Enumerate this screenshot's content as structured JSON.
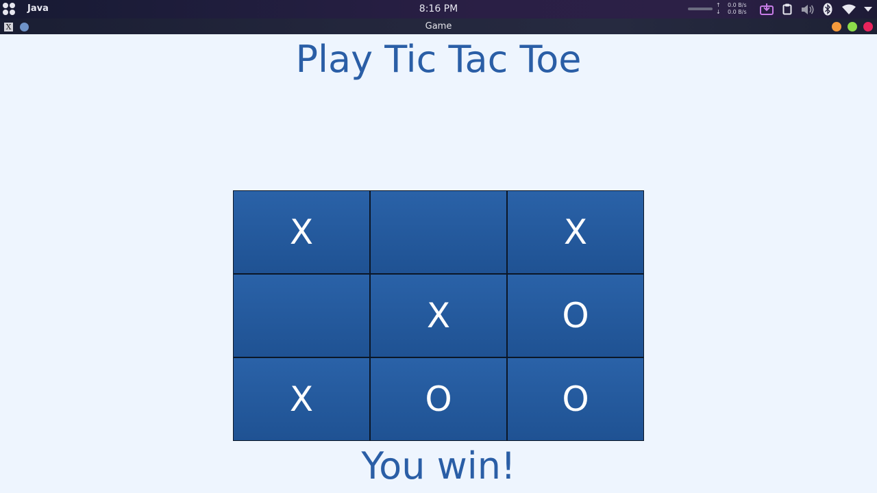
{
  "system_panel": {
    "app_name": "Java",
    "clock": "8:16 PM",
    "net_upload_arrow": "↑",
    "net_download_arrow": "↓",
    "net_upload_speed": "0.0 B/s",
    "net_download_speed": "0.0 B/s",
    "tray_icons": [
      "download-manager-icon",
      "clipboard-icon",
      "volume-icon",
      "bluetooth-icon",
      "wifi-icon",
      "chevron-down-icon"
    ]
  },
  "window": {
    "title": "Game",
    "app_icon_glyph": "X",
    "buttons": {
      "minimize_color": "#f59a3c",
      "maximize_color": "#8ddc4a",
      "close_color": "#e8245c"
    }
  },
  "game": {
    "title": "Play Tic Tac Toe",
    "board": [
      "X",
      "",
      "X",
      "",
      "X",
      "O",
      "X",
      "O",
      "O"
    ],
    "result": "You win!"
  },
  "colors": {
    "accent_text": "#2a5ea6",
    "cell_fill": "#245a9e",
    "background": "#eef5fe"
  }
}
